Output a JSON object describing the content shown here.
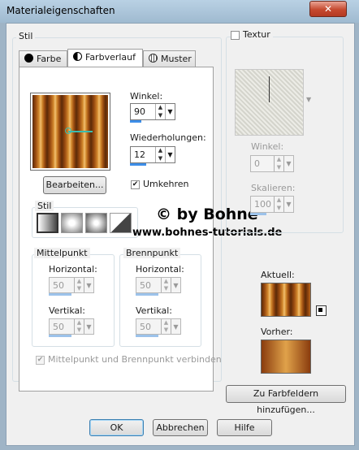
{
  "window": {
    "title": "Materialeigenschaften",
    "close_glyph": "✕"
  },
  "stil_group": {
    "label": "Stil"
  },
  "tabs": [
    {
      "label": "Farbe",
      "icon": "solid-color-icon"
    },
    {
      "label": "Farbverlauf",
      "icon": "gradient-icon"
    },
    {
      "label": "Muster",
      "icon": "pattern-icon"
    }
  ],
  "gradient": {
    "winkel_label": "Winkel:",
    "winkel_value": "90",
    "wiederholungen_label": "Wiederholungen:",
    "wiederholungen_value": "12",
    "edit_button": "Bearbeiten...",
    "invert_label": "Umkehren",
    "invert_checked": true,
    "style_label": "Stil",
    "style_buttons": [
      "linear-style",
      "rectangular-style",
      "radial-style",
      "sunburst-style"
    ]
  },
  "mittelpunkt": {
    "label": "Mittelpunkt",
    "horizontal_label": "Horizontal:",
    "horizontal_value": "50",
    "vertikal_label": "Vertikal:",
    "vertikal_value": "50"
  },
  "brennpunkt": {
    "label": "Brennpunkt",
    "horizontal_label": "Horizontal:",
    "horizontal_value": "50",
    "vertikal_label": "Vertikal:",
    "vertikal_value": "50"
  },
  "link_label": "Mittelpunkt und Brennpunkt verbinden",
  "watermark": {
    "line1": "© by Bohne",
    "line2": "www.bohnes-tutorials.de"
  },
  "textur": {
    "label": "Textur",
    "winkel_label": "Winkel:",
    "winkel_value": "0",
    "skalieren_label": "Skalieren:",
    "skalieren_value": "100"
  },
  "preview": {
    "aktuell_label": "Aktuell:",
    "vorher_label": "Vorher:"
  },
  "add_swatch_button": "Zu Farbfeldern hinzufügen...",
  "footer": {
    "ok": "OK",
    "cancel": "Abbrechen",
    "help": "Hilfe"
  }
}
